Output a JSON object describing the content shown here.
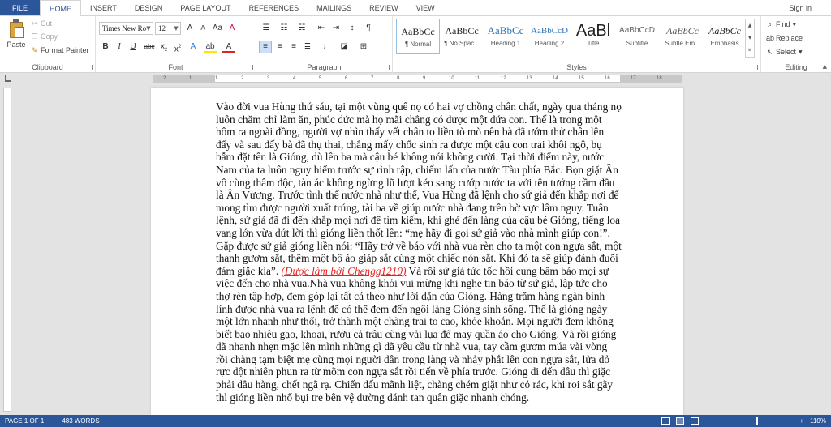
{
  "ribbon_tabs": [
    {
      "label": "FILE"
    },
    {
      "label": "HOME"
    },
    {
      "label": "INSERT"
    },
    {
      "label": "DESIGN"
    },
    {
      "label": "PAGE LAYOUT"
    },
    {
      "label": "REFERENCES"
    },
    {
      "label": "MAILINGS"
    },
    {
      "label": "REVIEW"
    },
    {
      "label": "VIEW"
    }
  ],
  "sign_in": "Sign in",
  "clipboard": {
    "paste": "Paste",
    "cut": "Cut",
    "copy": "Copy",
    "format_painter": "Format Painter",
    "label": "Clipboard"
  },
  "font": {
    "name": "Times New Ro",
    "size": "12",
    "label": "Font",
    "grow": "A",
    "shrink": "A",
    "case": "Aa",
    "clear": "A",
    "bold": "B",
    "italic": "I",
    "underline": "U",
    "strike": "abc",
    "subscript": "x",
    "superscript": "x",
    "effects": "A",
    "highlight": "ab",
    "color": "A"
  },
  "paragraph": {
    "label": "Paragraph",
    "pilcrow": "¶"
  },
  "styles": {
    "label": "Styles",
    "items": [
      {
        "preview": "AaBbCc",
        "name": "¶ Normal"
      },
      {
        "preview": "AaBbCc",
        "name": "¶ No Spac..."
      },
      {
        "preview": "AaBbCc",
        "name": "Heading 1"
      },
      {
        "preview": "AaBbCcD",
        "name": "Heading 2"
      },
      {
        "preview": "AaBl",
        "name": "Title"
      },
      {
        "preview": "AaBbCcD",
        "name": "Subtitle"
      },
      {
        "preview": "AaBbCc",
        "name": "Subtle Em..."
      },
      {
        "preview": "AaBbCc",
        "name": "Emphasis"
      }
    ]
  },
  "editing": {
    "label": "Editing",
    "find": "Find",
    "replace": "Replace",
    "select": "Select"
  },
  "ruler_ticks": [
    "2",
    "1",
    "1",
    "2",
    "3",
    "4",
    "5",
    "6",
    "7",
    "8",
    "9",
    "10",
    "11",
    "12",
    "13",
    "14",
    "15",
    "16",
    "17",
    "18"
  ],
  "document": {
    "text_before": "Vào đời vua Hùng thứ sáu, tại một vùng quê nọ có hai vợ chồng chân chất, ngày qua tháng nọ luôn chăm chỉ làm ăn, phúc đức mà họ mãi chẳng có được một đứa con. Thế là trong một hôm ra ngoài đồng, người vợ nhìn thấy vết chân to liền tò mò nên bà đã ướm thử chân lên đấy và sau đấy bà đã thụ thai, chẳng mấy chốc sinh ra được một cậu con trai khôi ngô, bụ bẫm đặt tên là Gióng, dù lên ba mà cậu bé không nói không cười. Tại thời điểm này, nước Nam của ta luôn nguy hiểm trước sự rình rập, chiếm lấn của nước Tàu phía Bắc. Bọn giặt Ân vô cùng thâm độc, tàn ác không ngừng lũ lượt kéo sang cướp nước ta với tên tướng cầm đầu là Ân Vương. Trước tình thế nước nhà như thế, Vua Hùng đã lệnh cho sứ giả đến khắp nơi để mong tìm được người xuất trúng, tài ba về giúp nước nhà đang trên bờ vực lâm nguy. Tuân lệnh, sứ giả đã đi đến khắp mọi nơi để tìm kiếm, khi ghé đến làng của cậu bé Gióng, tiếng loa vang lớn vừa dứt lời thì gióng liền thốt lên: “mẹ hãy đi gọi sứ giả vào nhà mình giúp con!”. Gặp được sứ giả gióng liền nói: “Hãy trở về báo với nhà vua rèn cho ta một con ngựa sắt, một thanh gươm sắt, thêm một bộ áo giáp sắt cùng một chiếc nón sắt. Khi đó ta sẽ giúp đánh đuổi đám giặc kia”. ",
    "credit": "(Được làm bởi Chengg1210)",
    "text_after": "  Và rồi sứ giả tức tốc hồi cung bẩm báo mọi sự việc đến cho nhà vua.Nhà vua không khỏi vui mừng khi nghe tin báo từ sứ giả, lập tức cho thợ rèn tập hợp, đem góp lại tất cả theo như lời dặn của Gióng. Hàng trăm hàng ngàn binh lính được nhà vua ra lệnh để có thể đem đến ngôi làng Gióng sinh sống. Thế là gióng ngày một lớn nhanh như thổi, trở thành một chàng trai to cao, khỏe khoắn. Mọi người đem không biết bao nhiêu gạo, khoai, rượu cả trâu cùng vải lụa để may quần áo cho Gióng. Và rồi gióng đã nhanh nhẹn mặc lên mình những gì đã yêu cầu từ nhà vua, tay cầm gươm múa vài vòng rồi chàng tạm biệt mẹ cùng mọi người dân trong làng và nhảy phắt lên con ngựa sắt, lửa đỏ rực đột nhiên phun ra từ mõm con ngựa sắt rồi tiến về phía trước. Gióng đi đến đâu thì giặc phải đầu hàng, chết ngã rạ. Chiến đấu mãnh liệt, chàng chém giặt như cỏ rác, khi roi sắt gãy thì gióng liền nhổ bụi tre bên vệ đường đánh tan quân giặc nhanh chóng."
  },
  "status": {
    "page": "PAGE 1 OF 1",
    "words": "483 WORDS",
    "zoom": "110%"
  },
  "colors": {
    "accent": "#2b579a",
    "credit_red": "#e02424"
  }
}
